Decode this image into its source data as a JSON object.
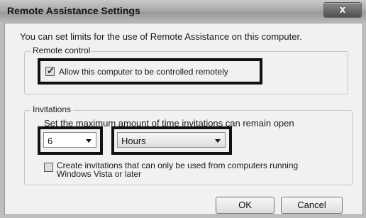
{
  "window": {
    "title": "Remote Assistance Settings",
    "close_symbol": "x"
  },
  "intro_text": "You can set limits for the use of Remote Assistance on this computer.",
  "remote_control": {
    "group_label": "Remote control",
    "checkbox_label": "Allow this computer to be controlled remotely",
    "checked": true
  },
  "invitations": {
    "group_label": "Invitations",
    "description": "Set the maximum amount of time invitations can remain open",
    "amount_value": "6",
    "unit_value": "Hours",
    "vista_checkbox_line1": "Create invitations that can only be used from computers running",
    "vista_checkbox_line2": "Windows Vista or later",
    "vista_checked": false
  },
  "buttons": {
    "ok": "OK",
    "cancel": "Cancel"
  }
}
